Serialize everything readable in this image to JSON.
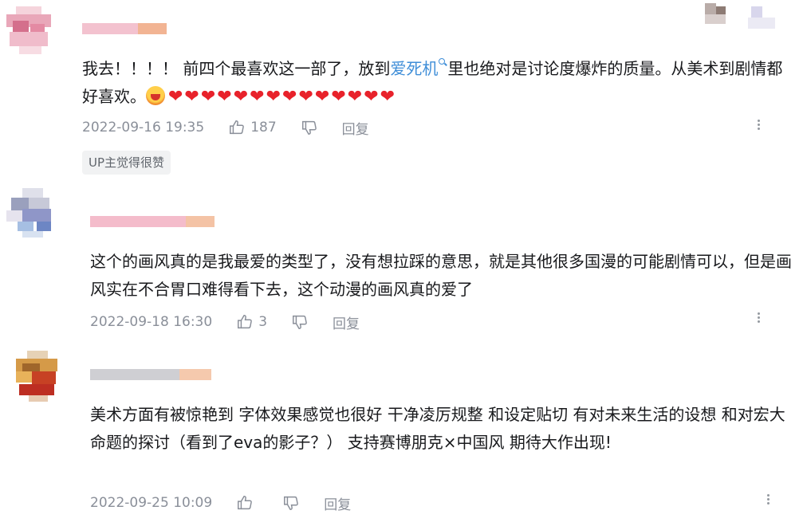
{
  "comments": [
    {
      "text_before": "我去！！！！ 前四个最喜欢这一部了，放到",
      "link": "爱死机",
      "text_after": "里也绝对是讨论度爆炸的质量。从美术到剧情都好喜欢。",
      "hearts": "❤❤❤❤❤❤❤❤❤❤❤❤❤❤",
      "time": "2022-09-16 19:35",
      "likes": "187",
      "reply": "回复",
      "badge": "UP主觉得很赞"
    },
    {
      "text": "这个的画风真的是我最爱的类型了，没有想拉踩的意思，就是其他很多国漫的可能剧情可以，但是画风实在不合胃口难得看下去，这个动漫的画风真的爱了",
      "time": "2022-09-18 16:30",
      "likes": "3",
      "reply": "回复"
    },
    {
      "text": "美术方面有被惊艳到  字体效果感觉也很好  干净凌厉规整  和设定贴切  有对未来生活的设想  和对宏大命题的探讨（看到了eva的影子？） 支持赛博朋克×中国风  期待大作出现!",
      "time": "2022-09-25 10:09",
      "likes": "",
      "reply": "回复"
    }
  ],
  "icons": {
    "like": "thumbs-up-icon",
    "dislike": "thumbs-down-icon",
    "more": "more-vertical-icon",
    "link": "search-icon",
    "emoji": "laughing-emoji-icon"
  },
  "colors": {
    "text": "#18191c",
    "meta": "#8a8f99",
    "link": "#3f8ed8",
    "heart": "#e8222b"
  }
}
